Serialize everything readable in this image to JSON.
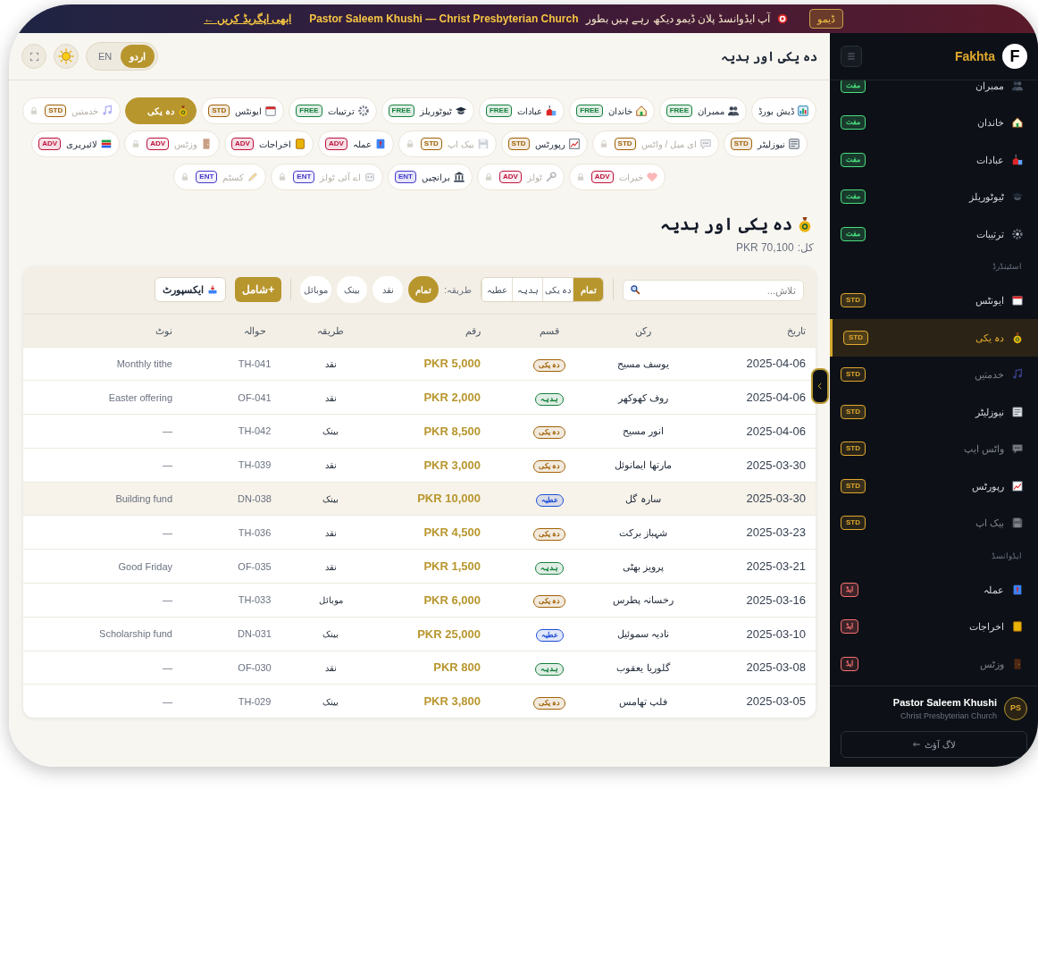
{
  "banner": {
    "badge": "ڈیمو",
    "message": "آپ ایڈوانسڈ پلان ڈیمو دیکھ رہے ہیں بطور",
    "account": "Pastor Saleem Khushi — Christ Presbyterian Church",
    "link": "ابھی اپگریڈ کریں ←"
  },
  "header": {
    "title": "دہ یکی اور ہدیہ",
    "languages": [
      {
        "label": "اردو",
        "selected": true
      },
      {
        "label": "EN",
        "selected": false
      }
    ]
  },
  "nav_chips": [
    [
      {
        "kind": "dashboard",
        "label": "ڈیش بورڈ",
        "selected": false,
        "locked": false
      },
      {
        "kind": "members",
        "label": "ممبران",
        "badge": "FREE",
        "color": "#15803d",
        "selected": false,
        "locked": false
      },
      {
        "kind": "families",
        "label": "خاندان",
        "badge": "FREE",
        "color": "#15803d",
        "selected": false,
        "locked": false
      },
      {
        "kind": "services",
        "label": "عبادات",
        "badge": "FREE",
        "color": "#15803d",
        "selected": false,
        "locked": false
      },
      {
        "kind": "tutorials",
        "label": "ٹیوٹوریلز",
        "badge": "FREE",
        "color": "#15803d",
        "selected": false,
        "locked": false
      },
      {
        "kind": "settings",
        "label": "ترتیبات",
        "badge": "FREE",
        "color": "#15803d",
        "selected": false,
        "locked": false
      },
      {
        "kind": "events",
        "label": "ایونٹس",
        "badge": "STD",
        "color": "#a16207",
        "selected": false,
        "locked": false
      },
      {
        "kind": "tithe",
        "label": "دہ یکی",
        "selected": true,
        "locked": false
      },
      {
        "kind": "ministries",
        "label": "خدمتیں",
        "badge": "STD",
        "color": "#a16207",
        "selected": false,
        "locked": true
      }
    ],
    [
      {
        "kind": "newsletter",
        "label": "نیوزلیٹر",
        "badge": "STD",
        "color": "#a16207",
        "selected": false,
        "locked": false
      },
      {
        "kind": "messaging",
        "label": "ای میل / واٹس",
        "badge": "STD",
        "color": "#a16207",
        "selected": false,
        "locked": true
      },
      {
        "kind": "reports",
        "label": "رپورٹس",
        "badge": "STD",
        "color": "#a16207",
        "selected": false,
        "locked": false
      },
      {
        "kind": "backup",
        "label": "بیک اپ",
        "badge": "STD",
        "color": "#a16207",
        "selected": false,
        "locked": true
      },
      {
        "kind": "staff",
        "label": "عملہ",
        "badge": "ADV",
        "color": "#be123c",
        "selected": false,
        "locked": false
      },
      {
        "kind": "expenses",
        "label": "اخراجات",
        "badge": "ADV",
        "color": "#be123c",
        "selected": false,
        "locked": false
      },
      {
        "kind": "visits",
        "label": "وزٹس",
        "badge": "ADV",
        "color": "#be123c",
        "selected": false,
        "locked": true
      },
      {
        "kind": "library",
        "label": "لائبریری",
        "badge": "ADV",
        "color": "#be123c",
        "selected": false,
        "locked": false
      }
    ],
    [
      {
        "kind": "charity",
        "label": "خیرات",
        "badge": "ADV",
        "color": "#be123c",
        "selected": false,
        "locked": true
      },
      {
        "kind": "tools",
        "label": "ٹولز",
        "badge": "ADV",
        "color": "#be123c",
        "selected": false,
        "locked": true
      },
      {
        "kind": "branches",
        "label": "برانچیں",
        "badge": "ENT",
        "color": "#4338ca",
        "selected": false,
        "locked": false
      },
      {
        "kind": "ai",
        "label": "اے آئی ٹولز",
        "badge": "ENT",
        "color": "#4338ca",
        "selected": false,
        "locked": true
      },
      {
        "kind": "custom",
        "label": "کسٹم",
        "badge": "ENT",
        "color": "#4338ca",
        "selected": false,
        "locked": true
      }
    ]
  ],
  "page": {
    "title": "دہ یکی اور ہدیہ",
    "total_label": "کل:",
    "total": "PKR 70,100"
  },
  "toolbar": {
    "search_placeholder": "تلاش...",
    "type_filters": [
      {
        "label": "تمام",
        "selected": true
      },
      {
        "label": "دہ یکی",
        "selected": false
      },
      {
        "label": "ہدیہ",
        "selected": false
      },
      {
        "label": "عطیہ",
        "selected": false
      }
    ],
    "method_label": "طریقہ:",
    "method_filters": [
      {
        "label": "تمام",
        "selected": true
      },
      {
        "label": "نقد",
        "selected": false
      },
      {
        "label": "بینک",
        "selected": false
      },
      {
        "label": "موبائل",
        "selected": false
      }
    ],
    "add_button": "+شامل",
    "export_button": "ایکسپورٹ"
  },
  "table": {
    "columns": [
      "تاریخ",
      "رکن",
      "قسم",
      "رقم",
      "طریقہ",
      "حوالہ",
      "نوٹ"
    ],
    "rows": [
      {
        "date": "2025-04-06",
        "member": "یوسف مسیح",
        "color": "#a16207",
        "type_label": "دہ یکی",
        "amount": "PKR 5,000",
        "method": "نقد",
        "ref": "TH-041",
        "note": "Monthly tithe",
        "selected": false
      },
      {
        "date": "2025-04-06",
        "member": "روف کھوکھر",
        "color": "#15803d",
        "type_label": "ہدیہ",
        "amount": "PKR 2,000",
        "method": "نقد",
        "ref": "OF-041",
        "note": "Easter offering",
        "selected": false
      },
      {
        "date": "2025-04-06",
        "member": "انور مسیح",
        "color": "#a16207",
        "type_label": "دہ یکی",
        "amount": "PKR 8,500",
        "method": "بینک",
        "ref": "TH-042",
        "note": "—",
        "selected": false
      },
      {
        "date": "2025-03-30",
        "member": "مارتھا ایمانوئل",
        "color": "#a16207",
        "type_label": "دہ یکی",
        "amount": "PKR 3,000",
        "method": "نقد",
        "ref": "TH-039",
        "note": "—",
        "selected": false
      },
      {
        "date": "2025-03-30",
        "member": "سارہ گل",
        "color": "#1d4ed8",
        "type_label": "عطیہ",
        "amount": "PKR 10,000",
        "method": "بینک",
        "ref": "DN-038",
        "note": "Building fund",
        "selected": true
      },
      {
        "date": "2025-03-23",
        "member": "شہباز برکت",
        "color": "#a16207",
        "type_label": "دہ یکی",
        "amount": "PKR 4,500",
        "method": "نقد",
        "ref": "TH-036",
        "note": "—",
        "selected": false
      },
      {
        "date": "2025-03-21",
        "member": "پرویز بھٹی",
        "color": "#15803d",
        "type_label": "ہدیہ",
        "amount": "PKR 1,500",
        "method": "نقد",
        "ref": "OF-035",
        "note": "Good Friday",
        "selected": false
      },
      {
        "date": "2025-03-16",
        "member": "رخسانہ پطرس",
        "color": "#a16207",
        "type_label": "دہ یکی",
        "amount": "PKR 6,000",
        "method": "موبائل",
        "ref": "TH-033",
        "note": "—",
        "selected": false
      },
      {
        "date": "2025-03-10",
        "member": "نادیہ سموئیل",
        "color": "#1d4ed8",
        "type_label": "عطیہ",
        "amount": "PKR 25,000",
        "method": "بینک",
        "ref": "DN-031",
        "note": "Scholarship fund",
        "selected": false
      },
      {
        "date": "2025-03-08",
        "member": "گلوریا یعقوب",
        "color": "#15803d",
        "type_label": "ہدیہ",
        "amount": "PKR 800",
        "method": "نقد",
        "ref": "OF-030",
        "note": "—",
        "selected": false
      },
      {
        "date": "2025-03-05",
        "member": "فلپ تھامس",
        "color": "#a16207",
        "type_label": "دہ یکی",
        "amount": "PKR 3,800",
        "method": "بینک",
        "ref": "TH-029",
        "note": "—",
        "selected": false
      }
    ]
  },
  "sidebar": {
    "logo": "F",
    "brand": "Fakhta",
    "sections": [
      {
        "items": [
          {
            "kind": "members",
            "label": "ممبران",
            "badge": "مفت",
            "color": "#4ade80",
            "selected": false,
            "locked": false
          },
          {
            "kind": "families",
            "label": "خاندان",
            "badge": "مفت",
            "color": "#4ade80",
            "selected": false,
            "locked": false
          },
          {
            "kind": "services",
            "label": "عبادات",
            "badge": "مفت",
            "color": "#4ade80",
            "selected": false,
            "locked": false
          },
          {
            "kind": "tutorials",
            "label": "ٹیوٹوریلز",
            "badge": "مفت",
            "color": "#4ade80",
            "selected": false,
            "locked": false
          },
          {
            "kind": "settings",
            "label": "ترتیبات",
            "badge": "مفت",
            "color": "#4ade80",
            "selected": false,
            "locked": false
          }
        ]
      },
      {
        "title": "اسٹینڈرڈ",
        "items": [
          {
            "kind": "events",
            "label": "ایونٹس",
            "badge": "STD",
            "color": "#e0a82e",
            "selected": false,
            "locked": false
          },
          {
            "kind": "tithe",
            "label": "دہ یکی",
            "badge": "STD",
            "color": "#e0a82e",
            "selected": true,
            "locked": false
          },
          {
            "kind": "ministries",
            "label": "خدمتیں",
            "badge": "STD",
            "color": "#e0a82e",
            "selected": false,
            "locked": true
          },
          {
            "kind": "newsletter",
            "label": "نیوزلیٹر",
            "badge": "STD",
            "color": "#e0a82e",
            "selected": false,
            "locked": false
          },
          {
            "kind": "messaging",
            "label": "واٹس ایپ",
            "badge": "STD",
            "color": "#e0a82e",
            "selected": false,
            "locked": true
          },
          {
            "kind": "reports",
            "label": "رپورٹس",
            "badge": "STD",
            "color": "#e0a82e",
            "selected": false,
            "locked": false
          },
          {
            "kind": "backup",
            "label": "بیک اپ",
            "badge": "STD",
            "color": "#e0a82e",
            "selected": false,
            "locked": true
          }
        ]
      },
      {
        "title": "ایڈوانسڈ",
        "items": [
          {
            "kind": "staff",
            "label": "عملہ",
            "badge": "ایڈ",
            "color": "#f87171",
            "selected": false,
            "locked": false
          },
          {
            "kind": "expenses",
            "label": "اخراجات",
            "badge": "ایڈ",
            "color": "#f87171",
            "selected": false,
            "locked": false
          },
          {
            "kind": "visits",
            "label": "وزٹس",
            "badge": "ایڈ",
            "color": "#f87171",
            "selected": false,
            "locked": true
          }
        ]
      }
    ],
    "user": {
      "initials": "PS",
      "name": "Pastor Saleem Khushi",
      "church": "Christ Presbyterian Church"
    },
    "logout": "لاگ آؤٹ"
  }
}
